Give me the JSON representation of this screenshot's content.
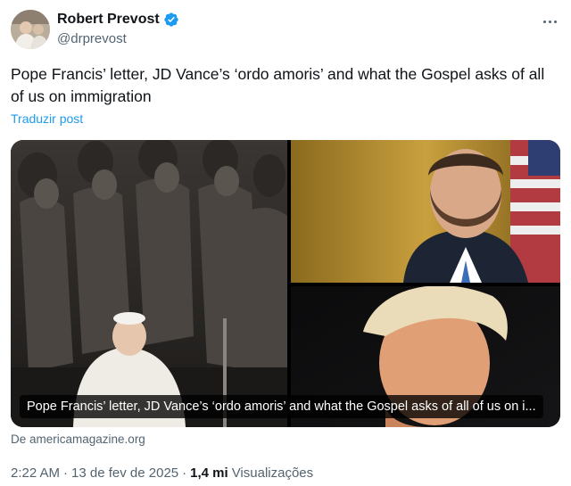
{
  "author": {
    "display_name": "Robert Prevost",
    "handle": "@drprevost",
    "verified": true
  },
  "tweet": {
    "text": "Pope Francis’ letter, JD Vance’s ‘ordo amoris’ and what the Gospel asks of all of us on immigration",
    "translate_label": "Traduzir post"
  },
  "card": {
    "title": "Pope Francis’ letter, JD Vance’s ‘ordo amoris’ and what the Gospel asks of all of us on i...",
    "source": "De americamagazine.org"
  },
  "meta": {
    "time": "2:22 AM",
    "separator": "·",
    "date": "13 de fev de 2025",
    "views_count": "1,4 mi",
    "views_label": "Visualizações"
  },
  "colors": {
    "accent": "#1d9bf0",
    "text": "#0f1419",
    "secondary": "#536471"
  },
  "icons": [
    "verified-badge-icon",
    "more-options-icon"
  ]
}
